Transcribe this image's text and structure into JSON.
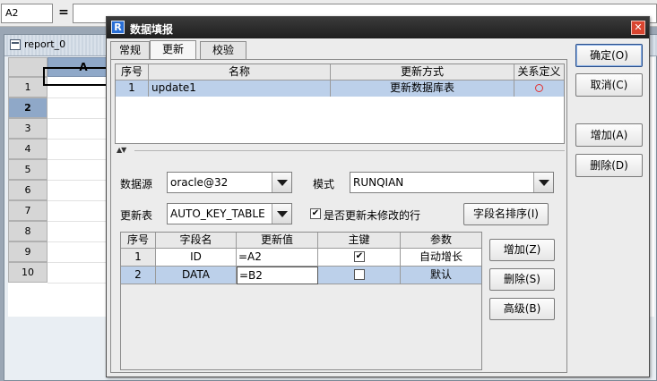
{
  "app": {
    "cell_ref": "A2",
    "formula_label": "=",
    "report_tab": "report_0",
    "column_header": "A",
    "rows": [
      "1",
      "2",
      "3",
      "4",
      "5",
      "6",
      "7",
      "8",
      "9",
      "10"
    ],
    "active_row": "2"
  },
  "dialog": {
    "title": "数据填报",
    "close_glyph": "✕",
    "tabs": [
      "常规",
      "更新",
      "校验"
    ],
    "active_tab": "更新",
    "update_table": {
      "headers": [
        "序号",
        "名称",
        "更新方式",
        "关系定义"
      ],
      "rows": [
        {
          "seq": "1",
          "name": "update1",
          "mode": "更新数据库表"
        }
      ]
    },
    "splitter_glyph": "▲▼",
    "datasource_label": "数据源",
    "datasource_value": "oracle@32",
    "schema_label": "模式",
    "schema_value": "RUNQIAN",
    "update_table_label": "更新表",
    "update_table_value": "AUTO_KEY_TABLE",
    "update_unmodified_label": "是否更新未修改的行",
    "update_unmodified_checked": true,
    "sort_fields_button": "字段名排序(I)",
    "fields_table": {
      "headers": [
        "序号",
        "字段名",
        "更新值",
        "主键",
        "参数"
      ],
      "rows": [
        {
          "seq": "1",
          "field": "ID",
          "value": "=A2",
          "key": true,
          "param": "自动增长"
        },
        {
          "seq": "2",
          "field": "DATA",
          "value": "=B2",
          "key": false,
          "param": "默认"
        }
      ]
    },
    "field_buttons": {
      "add": "增加(Z)",
      "delete": "删除(S)",
      "advanced": "高级(B)"
    },
    "side_buttons": {
      "ok": "确定(O)",
      "cancel": "取消(C)",
      "add": "增加(A)",
      "delete": "删除(D)"
    },
    "check_glyph": "✔"
  },
  "colors": {
    "selection": "#bcd0ea",
    "title_bar": "#2a2a2a",
    "relation_circle": "#e23030"
  }
}
